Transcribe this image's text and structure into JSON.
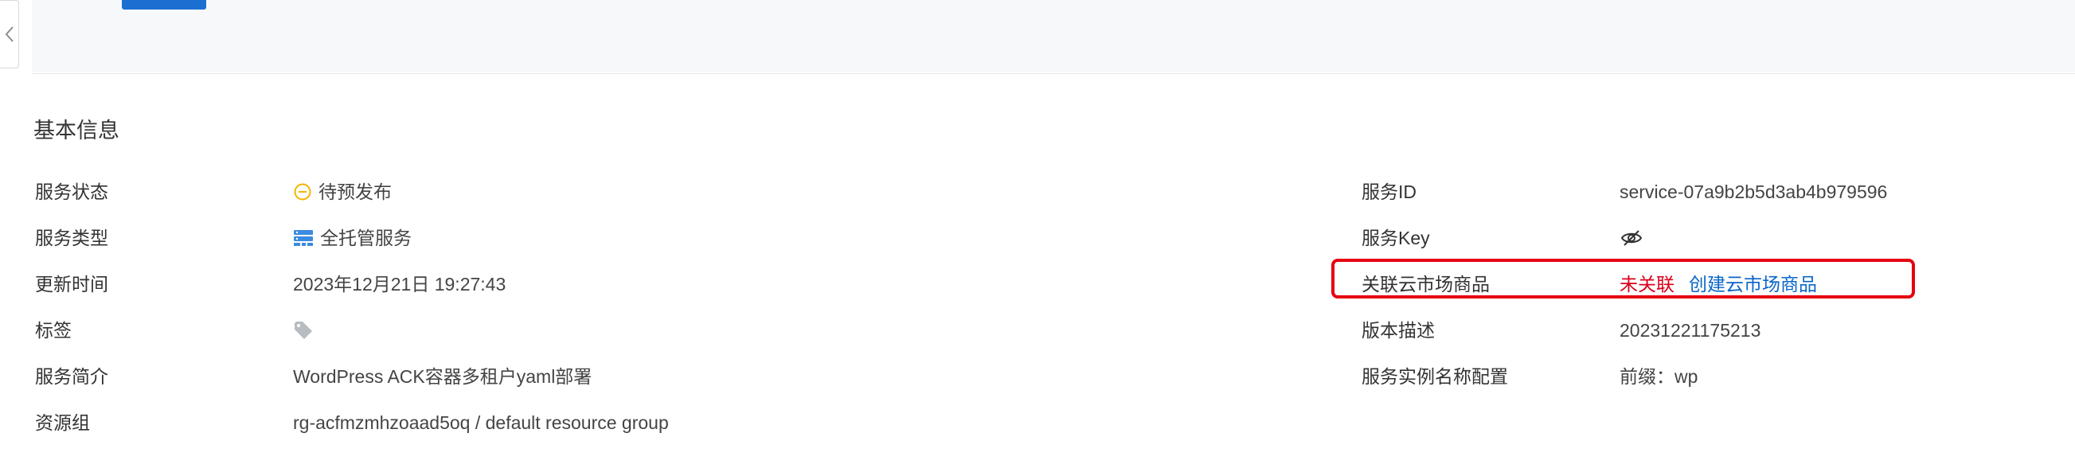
{
  "section": {
    "title": "基本信息"
  },
  "fields_left": [
    {
      "label": "服务状态",
      "value": "待预发布",
      "icon": "pending-circle-icon"
    },
    {
      "label": "服务类型",
      "value": "全托管服务",
      "icon": "server-icon"
    },
    {
      "label": "更新时间",
      "value": "2023年12月21日 19:27:43"
    },
    {
      "label": "标签",
      "value": "",
      "icon": "tag-icon"
    },
    {
      "label": "服务简介",
      "value": "WordPress ACK容器多租户yaml部署"
    },
    {
      "label": "资源组",
      "value": "rg-acfmzmhzoaad5oq / default resource group"
    }
  ],
  "fields_right": [
    {
      "label": "服务ID",
      "value": "service-07a9b2b5d3ab4b979596"
    },
    {
      "label": "服务Key",
      "value": "",
      "icon": "eye-off-icon"
    },
    {
      "label": "关联云市场商品",
      "value": "未关联",
      "link": "创建云市场商品"
    },
    {
      "label": "版本描述",
      "value": "20231221175213"
    },
    {
      "label": "服务实例名称配置",
      "value": "前缀：wp"
    }
  ],
  "colors": {
    "status_pending": "#f5b400",
    "link": "#0a66c8",
    "unlinked_red": "#d9001b",
    "highlight_border": "#e60012",
    "primary_button": "#1b6fd1"
  }
}
